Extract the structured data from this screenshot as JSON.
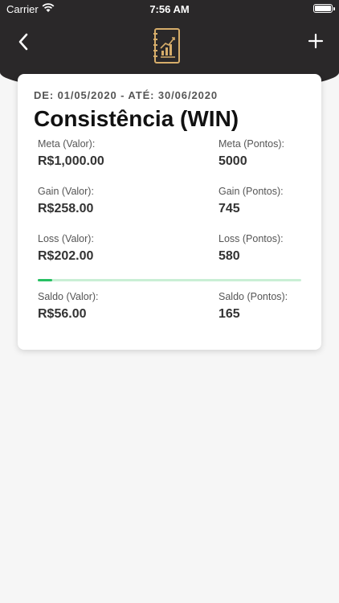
{
  "status_bar": {
    "carrier": "Carrier",
    "time": "7:56 AM"
  },
  "header": {
    "back_icon": "chevron-left-icon",
    "logo_icon": "notebook-chart-icon",
    "add_icon": "plus-icon"
  },
  "card": {
    "period": "DE: 01/05/2020 - ATÉ: 30/06/2020",
    "title": "Consistência (WIN)",
    "meta_valor_label": "Meta (Valor):",
    "meta_valor": "R$1,000.00",
    "meta_pontos_label": "Meta (Pontos):",
    "meta_pontos": "5000",
    "gain_valor_label": "Gain (Valor):",
    "gain_valor": "R$258.00",
    "gain_pontos_label": "Gain (Pontos):",
    "gain_pontos": "745",
    "loss_valor_label": "Loss (Valor):",
    "loss_valor": "R$202.00",
    "loss_pontos_label": "Loss (Pontos):",
    "loss_pontos": "580",
    "progress_fraction": 0.056,
    "saldo_valor_label": "Saldo (Valor):",
    "saldo_valor": "R$56.00",
    "saldo_pontos_label": "Saldo (Pontos):",
    "saldo_pontos": "165"
  },
  "colors": {
    "header_bg": "#2a2829",
    "logo_gold": "#d6ad6a",
    "progress_fill": "#27c063",
    "progress_track": "#c9efd5"
  }
}
